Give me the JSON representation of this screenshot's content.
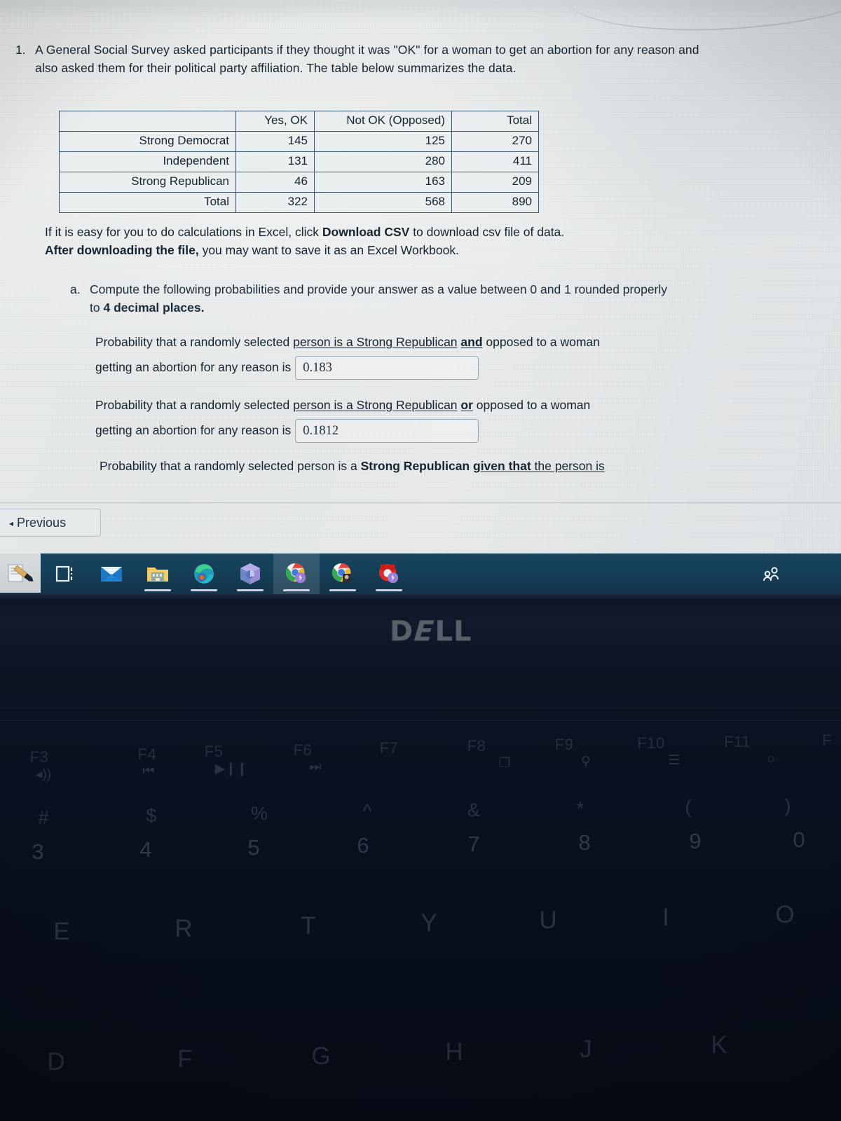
{
  "problem": {
    "number": "1.",
    "text": "A General Social Survey asked participants if they thought it was \"OK\" for a woman to get an abortion for any reason and also asked them for their political party affiliation. The table below summarizes the data."
  },
  "table": {
    "corner": "",
    "columns": [
      "Yes, OK",
      "Not OK (Opposed)",
      "Total"
    ],
    "rows": [
      {
        "label": "Strong Democrat",
        "values": [
          "145",
          "125",
          "270"
        ]
      },
      {
        "label": "Independent",
        "values": [
          "131",
          "280",
          "411"
        ]
      },
      {
        "label": "Strong Republican",
        "values": [
          "46",
          "163",
          "209"
        ]
      },
      {
        "label": "Total",
        "values": [
          "322",
          "568",
          "890"
        ]
      }
    ]
  },
  "csv_note": {
    "line1_a": "If it is easy for you to do calculations in Excel, click ",
    "line1_b": "Download CSV",
    "line1_c": " to download csv file of data.",
    "line2_a": "After downloading the file, ",
    "line2_b": "you may want to save it as an Excel Workbook."
  },
  "part_a": {
    "label": "a.",
    "line1": "Compute the following probabilities and provide your answer as a value between 0 and 1",
    "line2_a": "rounded properly to ",
    "line2_b": "4 decimal places."
  },
  "probabilities": [
    {
      "pre": "Probability that a randomly selected ",
      "u1": "person is a Strong Republican",
      "mid": " ",
      "u2": "and",
      "post": " opposed to a woman",
      "line2": "getting an abortion for any reason is",
      "answer": "0.183",
      "has_input": true
    },
    {
      "pre": "Probability that a randomly selected ",
      "u1": "person is a Strong Republican",
      "mid": " ",
      "u2": "or",
      "post": " opposed to a woman",
      "line2": "getting an abortion for any reason is",
      "answer": "0.1812",
      "has_input": true
    },
    {
      "pre": "Probability that a randomly selected person is a ",
      "u1": "Strong Republican",
      "mid": " ",
      "u2": "given that",
      "post": " the person is",
      "line2": "",
      "answer": "",
      "has_input": false
    }
  ],
  "navigation": {
    "previous_label": "Previous",
    "previous_caret": "◂"
  },
  "taskbar": {
    "ink_icon": "pen-and-notes-icon",
    "items": [
      {
        "name": "task-view",
        "label": "Task View",
        "active": false,
        "underline": false
      },
      {
        "name": "mail",
        "label": "Mail",
        "active": false,
        "underline": false
      },
      {
        "name": "file-explorer",
        "label": "File Explorer",
        "active": false,
        "underline": true
      },
      {
        "name": "microsoft-edge",
        "label": "Microsoft Edge",
        "active": false,
        "underline": true
      },
      {
        "name": "microsoft-365",
        "label": "Microsoft 365",
        "active": false,
        "underline": true
      },
      {
        "name": "google-chrome-1",
        "label": "Google Chrome",
        "active": true,
        "underline": true
      },
      {
        "name": "google-chrome-2",
        "label": "Google Chrome",
        "active": false,
        "underline": true
      },
      {
        "name": "recording-app",
        "label": "Recording",
        "active": false,
        "underline": true
      }
    ],
    "tray_icon": "people-share-icon"
  },
  "laptop": {
    "brand": "DELL",
    "brand_chars": [
      "D",
      "E",
      "L",
      "L"
    ]
  },
  "keyboard": {
    "function_row": [
      {
        "label": "F3",
        "icon": "◂))"
      },
      {
        "label": "F4",
        "icon": "⏮"
      },
      {
        "label": "F5",
        "icon": "▶❙❙"
      },
      {
        "label": "F6",
        "icon": "⏭"
      },
      {
        "label": "F7",
        "icon": ""
      },
      {
        "label": "F8",
        "icon": "❐"
      },
      {
        "label": "F9",
        "icon": "⚲"
      },
      {
        "label": "F10",
        "icon": "☰"
      },
      {
        "label": "F11",
        "icon": "☼"
      },
      {
        "label": "F",
        "icon": ""
      }
    ],
    "number_row": [
      {
        "top": "#",
        "bottom": "3"
      },
      {
        "top": "$",
        "bottom": "4"
      },
      {
        "top": "%",
        "bottom": "5"
      },
      {
        "top": "^",
        "bottom": "6"
      },
      {
        "top": "&",
        "bottom": "7"
      },
      {
        "top": "*",
        "bottom": "8"
      },
      {
        "top": "(",
        "bottom": "9"
      },
      {
        "top": ")",
        "bottom": "0"
      }
    ],
    "letter_row_1": [
      "E",
      "R",
      "T",
      "Y",
      "U",
      "I",
      "O"
    ],
    "letter_row_2": [
      "D",
      "F",
      "G",
      "H",
      "J",
      "K"
    ]
  },
  "colors": {
    "taskbar": "#16405a",
    "screen_bg": "#e6eaeb",
    "text": "#16242f",
    "deck": "#0a1120"
  }
}
